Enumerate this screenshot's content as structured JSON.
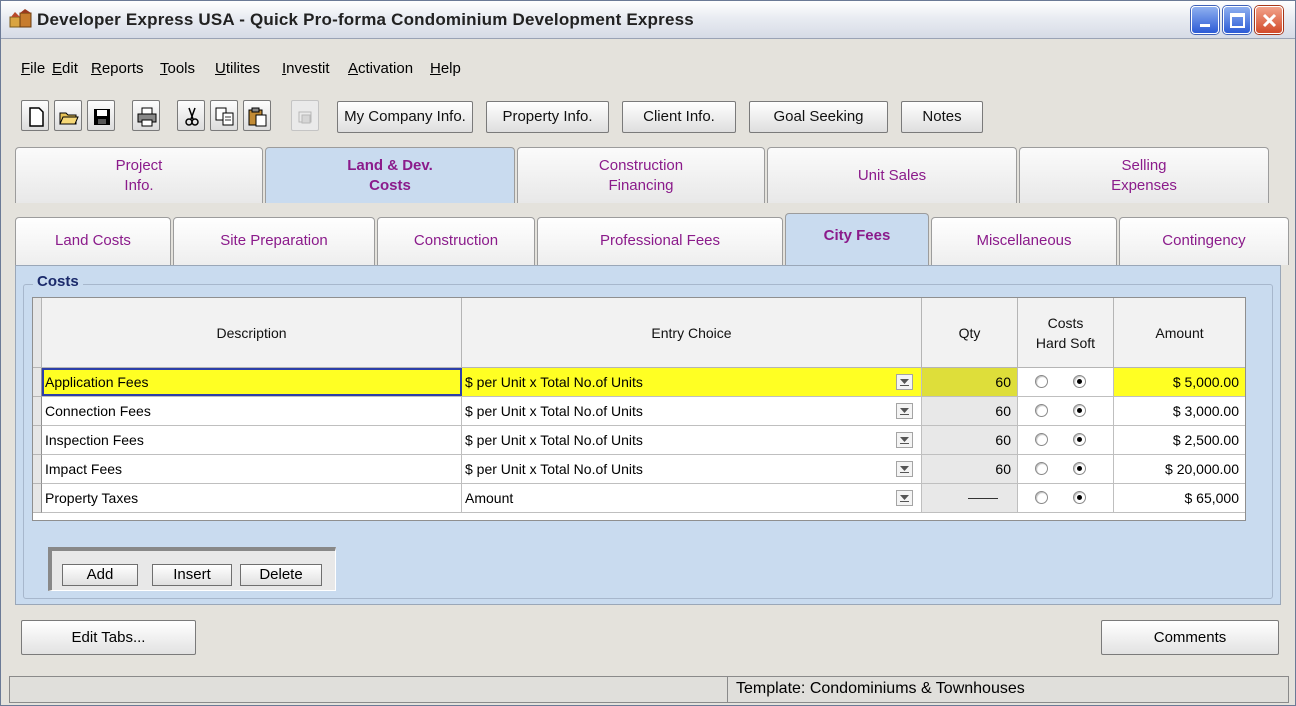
{
  "window": {
    "title": "Developer Express  USA - Quick Pro-forma Condominium Development Express"
  },
  "menu": [
    "File",
    "Edit",
    "Reports",
    "Tools",
    "Utilites",
    "Investit",
    "Activation",
    "Help"
  ],
  "toolbar": {
    "icons": [
      "new-icon",
      "open-folder-icon",
      "save-icon",
      "print-icon",
      "cut-icon",
      "copy-icon",
      "paste-icon",
      "disabled-icon"
    ],
    "buttons": [
      "My Company Info.",
      "Property Info.",
      "Client Info.",
      "Goal Seeking",
      "Notes"
    ]
  },
  "main_tabs": [
    {
      "line1": "Project",
      "line2": "Info."
    },
    {
      "line1": "Land & Dev.",
      "line2": "Costs"
    },
    {
      "line1": "Construction",
      "line2": "Financing"
    },
    {
      "line1": "Unit Sales",
      "line2": ""
    },
    {
      "line1": "Selling",
      "line2": "Expenses"
    }
  ],
  "sub_tabs": [
    "Land Costs",
    "Site Preparation",
    "Construction",
    "Professional Fees",
    "City Fees",
    "Miscellaneous",
    "Contingency"
  ],
  "group_label": "Costs",
  "grid": {
    "headers": {
      "description": "Description",
      "entry": "Entry Choice",
      "qty": "Qty",
      "costs_line1": "Costs",
      "costs_line2": "Hard Soft",
      "amount": "Amount"
    },
    "rows": [
      {
        "description": "Application Fees",
        "entry": "$ per Unit x Total No.of Units",
        "qty": "60",
        "amount": "$ 5,000.00"
      },
      {
        "description": "Connection Fees",
        "entry": "$ per Unit x Total No.of Units",
        "qty": "60",
        "amount": "$ 3,000.00"
      },
      {
        "description": "Inspection Fees",
        "entry": "$ per Unit x Total No.of Units",
        "qty": "60",
        "amount": "$ 2,500.00"
      },
      {
        "description": "Impact Fees",
        "entry": "$ per Unit x Total No.of Units",
        "qty": "60",
        "amount": "$ 20,000.00"
      },
      {
        "description": "Property  Taxes",
        "entry": "Amount",
        "qty": "",
        "amount": "$ 65,000"
      }
    ]
  },
  "row_buttons": [
    "Add",
    "Insert",
    "Delete"
  ],
  "edit_tabs_label": "Edit Tabs...",
  "comments_label": "Comments",
  "status": "Template: Condominiums & Townhouses",
  "colors": {
    "highlight": "#ffff23",
    "tab_active": "#c9dbef",
    "tab_text": "#8b1b8b"
  }
}
